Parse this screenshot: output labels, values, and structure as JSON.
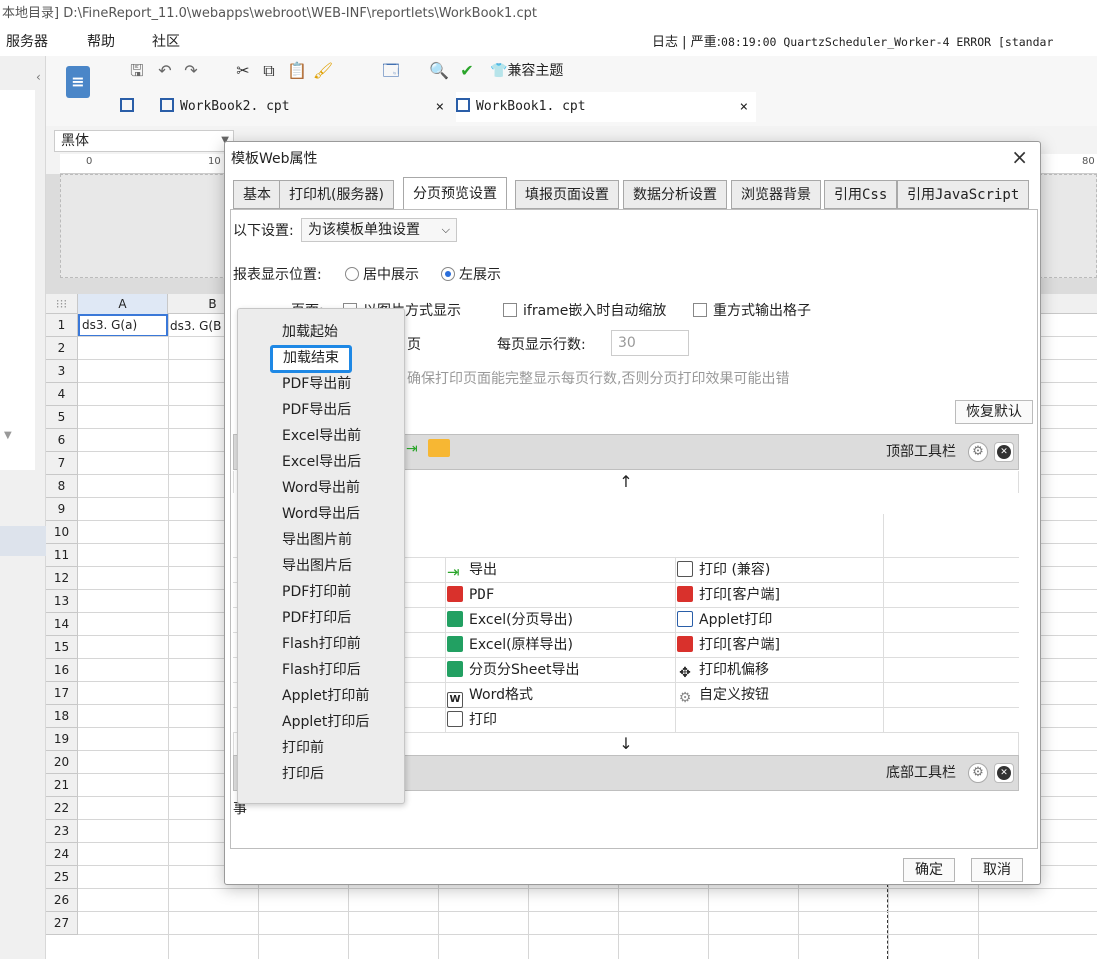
{
  "window": {
    "title": "本地目录]   D:\\FineReport_11.0\\webapps\\webroot\\WEB-INF\\reportlets\\WorkBook1.cpt"
  },
  "menubar": {
    "items": [
      "服务器",
      "帮助",
      "社区"
    ],
    "log_label": "日志 | 严重:",
    "log_text": "08:19:00 QuartzScheduler_Worker-4 ERROR [standar"
  },
  "toolbar": {
    "theme_label": "兼容主题",
    "tabs": [
      {
        "label": "WorkBook2. cpt",
        "close": "×"
      },
      {
        "label": "WorkBook1. cpt",
        "close": "×"
      }
    ]
  },
  "format_bar": {
    "font": "黑体"
  },
  "ruler": {
    "marks": [
      "0",
      "10",
      "80"
    ]
  },
  "grid": {
    "columns": [
      "A",
      "B"
    ],
    "rows": [
      "1",
      "2",
      "3",
      "4",
      "5",
      "6",
      "7",
      "8",
      "9",
      "10",
      "11",
      "12",
      "13",
      "14",
      "15",
      "16",
      "17",
      "18",
      "19",
      "20",
      "21",
      "22",
      "23",
      "24",
      "25",
      "26",
      "27"
    ],
    "cell_a1": "ds3. G(a)",
    "cell_b1": "ds3. G(B"
  },
  "dialog": {
    "title": "模板Web属性",
    "close": "×",
    "tabs": [
      "基本",
      "打印机(服务器)",
      "分页预览设置",
      "填报页面设置",
      "数据分析设置",
      "浏览器背景",
      "引用Css",
      "引用JavaScript"
    ],
    "active_tab": 2,
    "setting_label": "以下设置:",
    "setting_value": "为该模板单独设置",
    "position_label": "报表显示位置:",
    "radio_center": "居中展示",
    "radio_left": "左展示",
    "radio_selected": "left",
    "page_label": "页面:",
    "chk_image": "以图片方式显示",
    "chk_iframe": "iframe嵌入时自动缩放",
    "chk_repeat": "重方式输出格子",
    "page_split_tail": "页",
    "rows_label": "每页显示行数:",
    "rows_value": "30",
    "hint_text": "确保打印页面能完整显示每页行数,否则分页打印效果可能出错",
    "restore_button": "恢复默认",
    "top_toolbar_label": "顶部工具栏",
    "bottom_toolbar_label": "底部工具栏",
    "up_arrow": "↑",
    "down_arrow": "↓",
    "buttons_col1": [
      "导出",
      "PDF",
      "Excel(分页导出)",
      "Excel(原样导出)",
      "分页分Sheet导出",
      "Word格式",
      "打印"
    ],
    "buttons_col2": [
      "打印 (兼容)",
      "打印[客户端]",
      "Applet打印",
      "打印[客户端]",
      "打印机偏移",
      "自定义按钮"
    ],
    "stray_char": "事",
    "ok_button": "确定",
    "cancel_button": "取消"
  },
  "popup": {
    "items": [
      "加载起始",
      "加载结束",
      "PDF导出前",
      "PDF导出后",
      "Excel导出前",
      "Excel导出后",
      "Word导出前",
      "Word导出后",
      "导出图片前",
      "导出图片后",
      "PDF打印前",
      "PDF打印后",
      "Flash打印前",
      "Flash打印后",
      "Applet打印前",
      "Applet打印后",
      "打印前",
      "打印后"
    ],
    "highlighted_index": 1,
    "highlight_color": "#1e88e5"
  }
}
